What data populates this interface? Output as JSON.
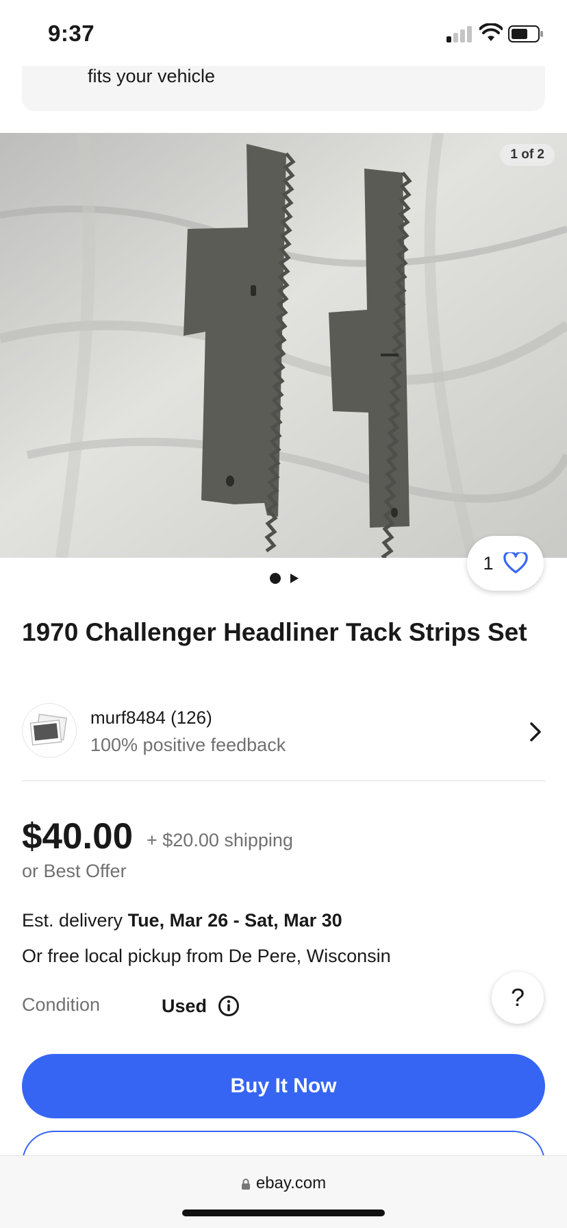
{
  "status_bar": {
    "time": "9:37"
  },
  "fitment": {
    "text": "fits your vehicle"
  },
  "gallery": {
    "counter": "1 of 2",
    "watchers": "1"
  },
  "listing": {
    "title": "1970 Challenger Headliner Tack Strips Set"
  },
  "seller": {
    "name": "murf8484 (126)",
    "feedback": "100% positive feedback"
  },
  "pricing": {
    "price": "$40.00",
    "shipping": "+ $20.00 shipping",
    "best_offer": "or Best Offer"
  },
  "delivery": {
    "label": "Est. delivery",
    "dates": "Tue, Mar 26 - Sat, Mar 30"
  },
  "pickup": {
    "text": "Or free local pickup from De Pere, Wisconsin"
  },
  "condition": {
    "label": "Condition",
    "value": "Used"
  },
  "help": {
    "label": "?"
  },
  "actions": {
    "buy_now": "Buy It Now"
  },
  "browser": {
    "url": "ebay.com"
  },
  "colors": {
    "accent": "#3665f3",
    "text": "#191919",
    "muted": "#707070"
  }
}
